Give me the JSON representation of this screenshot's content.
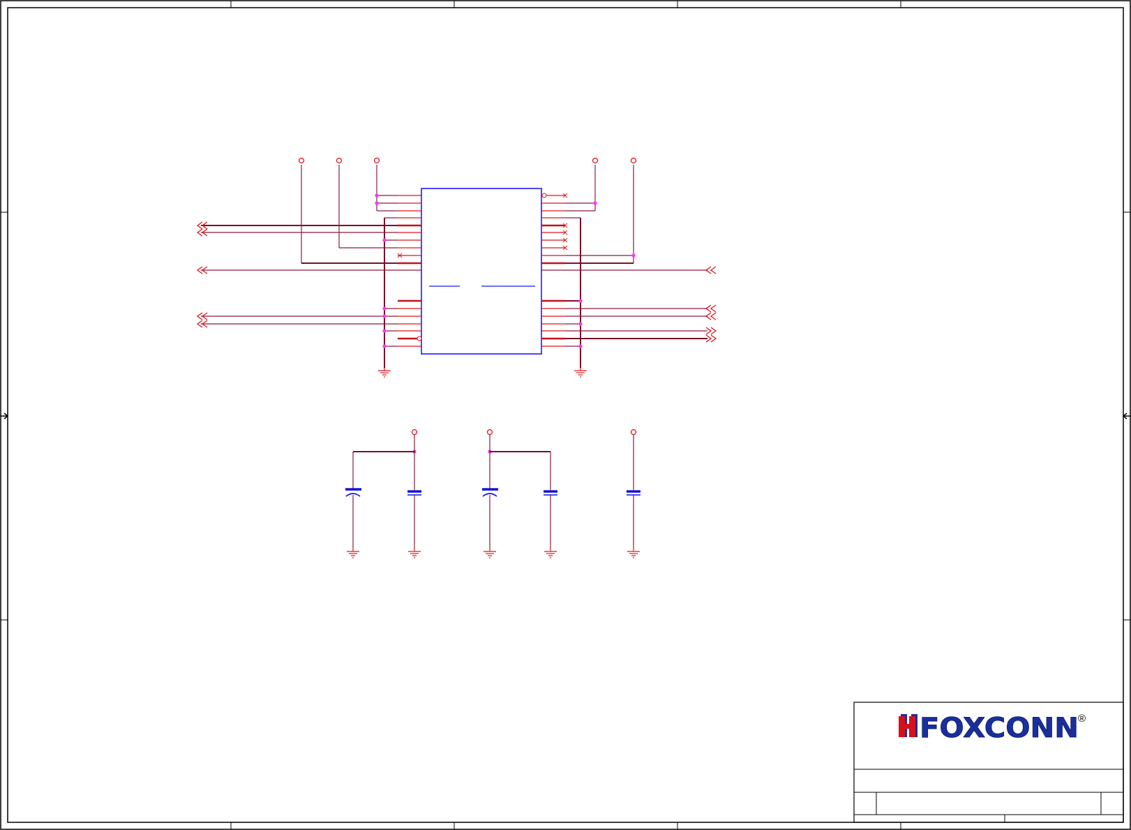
{
  "title_block": {
    "brand": "FOXCONN",
    "registered_mark": "®"
  },
  "colors": {
    "wire": "#8b1a3c",
    "pin": "#e0141c",
    "junction": "#ff33ff",
    "chip_outline": "#1b1bff",
    "capacitor": "#1212d8",
    "logo_red": "#d8101c",
    "logo_blue": "#1a2f9e"
  },
  "icons": {
    "power_symbol": "open-circle-vcc-icon",
    "ground_symbol": "ground-icon",
    "offpage_left": "double-chevron-left-icon",
    "offpage_right": "double-chevron-right-icon",
    "no_connect": "x-mark-icon"
  }
}
